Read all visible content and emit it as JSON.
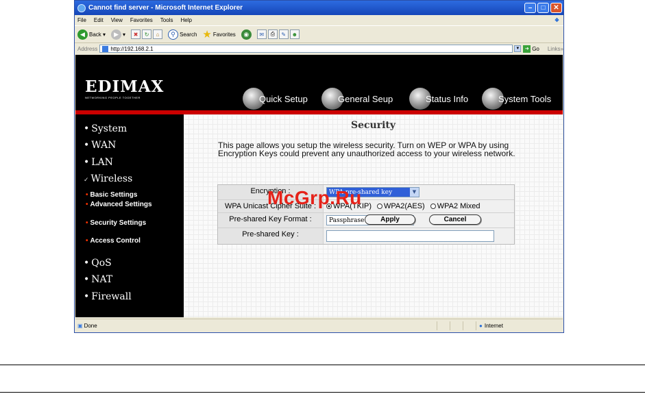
{
  "window": {
    "title": "Cannot find server - Microsoft Internet Explorer"
  },
  "menu": [
    "File",
    "Edit",
    "View",
    "Favorites",
    "Tools",
    "Help"
  ],
  "toolbar": {
    "back": "Back",
    "search": "Search",
    "favorites": "Favorites"
  },
  "address": {
    "label": "Address",
    "url": "http://192.168.2.1",
    "go": "Go",
    "links": "Links"
  },
  "router": {
    "logo": "EDIMAX",
    "tagline": "NETWORKING PEOPLE TOGETHER",
    "nav": [
      "Quick Setup",
      "General Seup",
      "Status Info",
      "System Tools"
    ]
  },
  "sidebar": {
    "items": [
      "System",
      "WAN",
      "LAN",
      "Wireless",
      "QoS",
      "NAT",
      "Firewall"
    ],
    "wireless_sub": [
      "Basic Settings",
      "Advanced Settings",
      "Security Settings",
      "Access Control"
    ]
  },
  "page": {
    "title": "Security",
    "description": "This page allows you setup the wireless security. Turn on WEP or WPA by using Encryption Keys could prevent any unauthorized access to your wireless network.",
    "fields": {
      "encryption_label": "Encryption :",
      "encryption_value": "WPA pre-shared key",
      "cipher_label": "WPA Unicast Cipher Suite :",
      "cipher_options": [
        "WPA(TKIP)",
        "WPA2(AES)",
        "WPA2 Mixed"
      ],
      "format_label": "Pre-shared Key Format :",
      "format_value": "Passphrase",
      "key_label": "Pre-shared Key :",
      "key_value": ""
    },
    "apply": "Apply",
    "cancel": "Cancel"
  },
  "status": {
    "left": "Done",
    "zone": "Internet"
  },
  "watermark": "McGrp.Ru"
}
